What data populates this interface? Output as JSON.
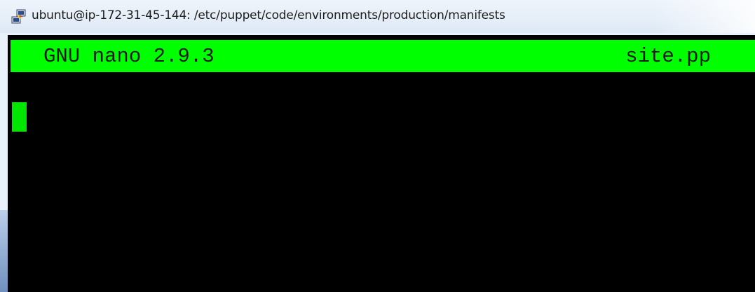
{
  "window": {
    "title": "ubuntu@ip-172-31-45-144: /etc/puppet/code/environments/production/manifests",
    "icon": "putty-icon"
  },
  "editor": {
    "name_version": "GNU nano 2.9.3",
    "filename": "site.pp",
    "content": ""
  },
  "colors": {
    "header_bg": "#00ff00",
    "terminal_bg": "#000000",
    "cursor": "#00e600"
  }
}
